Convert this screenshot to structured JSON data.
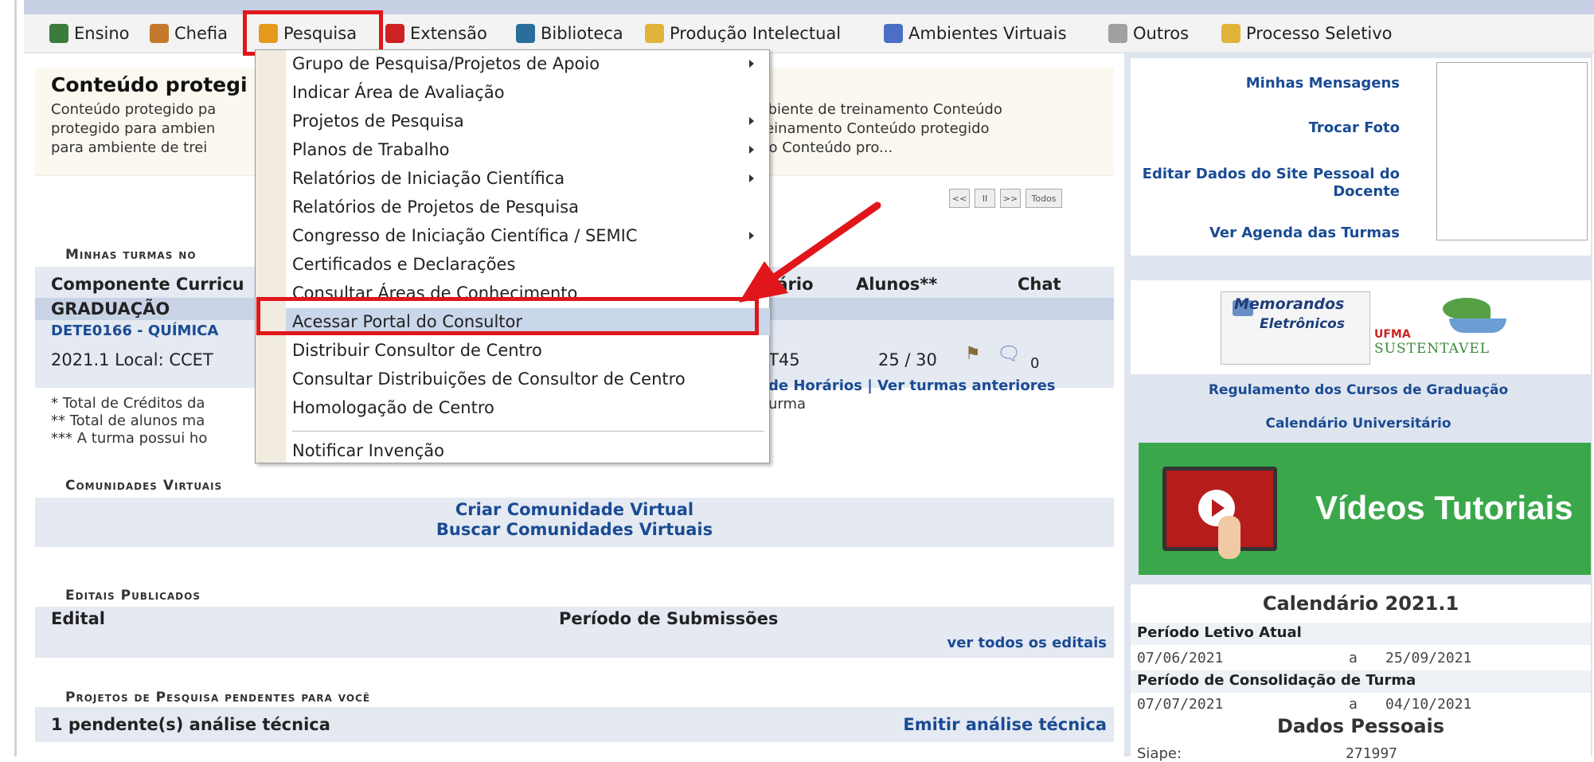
{
  "menu": [
    {
      "label": "Ensino",
      "icon": "book-icon",
      "color": "#3b7b3b"
    },
    {
      "label": "Chefia",
      "icon": "person-icon",
      "color": "#c47a2c"
    },
    {
      "label": "Pesquisa",
      "icon": "flask-icon",
      "color": "#e59a1e"
    },
    {
      "label": "Extensão",
      "icon": "heart-icon",
      "color": "#c22"
    },
    {
      "label": "Biblioteca",
      "icon": "library-icon",
      "color": "#2a6f9c"
    },
    {
      "label": "Produção Intelectual",
      "icon": "document-icon",
      "color": "#e0b33a"
    },
    {
      "label": "Ambientes Virtuais",
      "icon": "globe-icon",
      "color": "#4a6fc4"
    },
    {
      "label": "Outros",
      "icon": "cd-icon",
      "color": "#a0a0a0"
    },
    {
      "label": "Processo Seletivo",
      "icon": "document-icon",
      "color": "#e0b33a"
    }
  ],
  "dropdown": {
    "items": [
      {
        "label": "Grupo de Pesquisa/Projetos de Apoio",
        "submenu": true
      },
      {
        "label": "Indicar Área de Avaliação",
        "submenu": false
      },
      {
        "label": "Projetos de Pesquisa",
        "submenu": true
      },
      {
        "label": "Planos de Trabalho",
        "submenu": true
      },
      {
        "label": "Relatórios de Iniciação Científica",
        "submenu": true
      },
      {
        "label": "Relatórios de Projetos de Pesquisa",
        "submenu": false
      },
      {
        "label": "Congresso de Iniciação Científica / SEMIC",
        "submenu": true
      },
      {
        "label": "Certificados e Declarações",
        "submenu": false
      },
      {
        "label": "Consultar Áreas de Conhecimento",
        "submenu": false
      },
      {
        "label": "Acessar Portal do Consultor",
        "submenu": false,
        "highlighted": true
      },
      {
        "label": "Distribuir Consultor de Centro",
        "submenu": false
      },
      {
        "label": "Consultar Distribuições de Consultor de Centro",
        "submenu": false
      },
      {
        "label": "Homologação de Centro",
        "submenu": false
      },
      {
        "label": "Notificar Invenção",
        "submenu": false
      }
    ]
  },
  "content": {
    "title": "Conteúdo protegi",
    "desc_left": [
      "Conteúdo protegido pa",
      "protegido para ambien",
      "para ambiente de trei"
    ],
    "desc_right": [
      "mbiente de treinamento Conteúdo",
      "treinamento Conteúdo protegido",
      "nto Conteúdo pro..."
    ],
    "pager": {
      "first": "<<",
      "pause": "II",
      "next": ">>",
      "all": "Todos"
    }
  },
  "turmas": {
    "section_title": "Minhas turmas no",
    "col_componente": "Componente Curricu",
    "col_horario": "rário",
    "col_alunos": "Alunos**",
    "col_chat": "Chat",
    "group": "GRADUAÇÃO",
    "course_code": "DETE0166 - QUÍMICA",
    "local": "2021.1 Local: CCET",
    "horario": "T45",
    "alunos": "25 / 30",
    "chat_count": "0",
    "links_text": "de Horários | Ver turmas anteriores",
    "turma_word": "urma",
    "note1": "* Total de Créditos da",
    "note2": "** Total de alunos ma",
    "note3": "*** A turma possui ho"
  },
  "comunidades": {
    "title": "Comunidades Virtuais",
    "link1": "Criar Comunidade Virtual",
    "link2": "Buscar Comunidades Virtuais"
  },
  "editais": {
    "title": "Editais Publicados",
    "col_edital": "Edital",
    "col_periodo": "Período de Submissões",
    "link_all": "ver todos os editais"
  },
  "projetos": {
    "title": "Projetos de Pesquisa pendentes para você",
    "pending": "1 pendente(s) análise técnica",
    "action": "Emitir análise técnica"
  },
  "sidebar": {
    "links": [
      "Minhas Mensagens",
      "Trocar Foto",
      "Editar Dados do Site Pessoal do",
      "Docente",
      "Ver Agenda das Turmas"
    ],
    "memorandos_line1": "Memorandos",
    "memorandos_line2": "Eletrônicos",
    "ufma": "UFMA",
    "sustentavel": "SUSTENTAVEL",
    "regulamento": "Regulamento dos Cursos de Graduação",
    "calendario_link": "Calendário Universitário",
    "videos": "Vídeos Tutoriais",
    "calendar": {
      "title": "Calendário 2021.1",
      "label1": "Período Letivo Atual",
      "start1": "07/06/2021",
      "a1": "a",
      "end1": "25/09/2021",
      "label2": "Período de Consolidação de Turma",
      "start2": "07/07/2021",
      "a2": "a",
      "end2": "04/10/2021"
    },
    "dados_title": "Dados Pessoais",
    "siape_label": "Siape:",
    "siape_value": "271997"
  },
  "colors": {
    "highlight_red": "#e0161b",
    "link_blue": "#1a4b93",
    "panel_bg": "#dfe5ef",
    "green_banner": "#3aa84a"
  }
}
